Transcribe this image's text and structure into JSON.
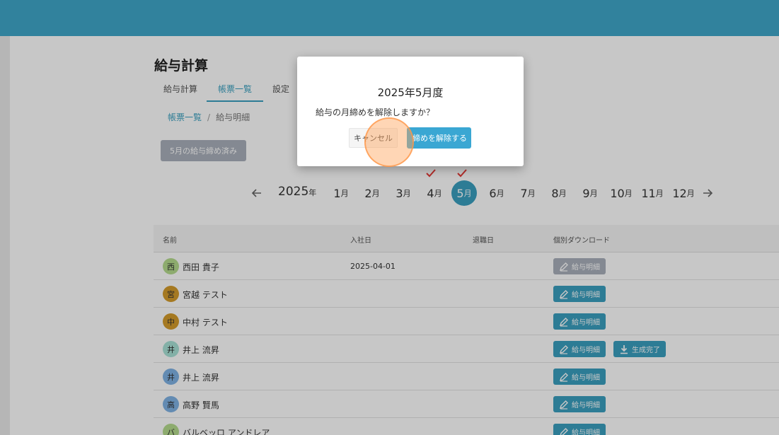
{
  "header": {
    "bar_color": "#3fa7c9"
  },
  "page": {
    "title": "給与計算",
    "tabs": [
      {
        "label": "給与計算",
        "active": false
      },
      {
        "label": "帳票一覧",
        "active": true
      },
      {
        "label": "設定",
        "active": false
      }
    ]
  },
  "breadcrumb": {
    "parent": "帳票一覧",
    "separator": "/",
    "current": "給与明細"
  },
  "status_button": {
    "label": "5月の給与締め済み"
  },
  "calendar": {
    "year": "2025",
    "year_suffix": "年",
    "month_suffix": "月",
    "months": [
      "1",
      "2",
      "3",
      "4",
      "5",
      "6",
      "7",
      "8",
      "9",
      "10",
      "11",
      "12"
    ],
    "selected_month": "5",
    "checked_months": [
      "4",
      "5"
    ]
  },
  "table": {
    "headers": {
      "name": "名前",
      "hire_date": "入社日",
      "leave_date": "退職日",
      "download": "個別ダウンロード"
    },
    "rows": [
      {
        "initial": "西",
        "name": "西田 貴子",
        "hire_date": "2025-04-01",
        "avatar_color": "#b5dc8e",
        "payslip": "給与明細",
        "payslip_disabled": true,
        "generated": ""
      },
      {
        "initial": "宮",
        "name": "宮越 テスト",
        "hire_date": "",
        "avatar_color": "#d49b2b",
        "payslip": "給与明細",
        "payslip_disabled": false,
        "generated": ""
      },
      {
        "initial": "中",
        "name": "中村 テスト",
        "hire_date": "",
        "avatar_color": "#d49b2b",
        "payslip": "給与明細",
        "payslip_disabled": false,
        "generated": ""
      },
      {
        "initial": "井",
        "name": "井上 流昇",
        "hire_date": "",
        "avatar_color": "#a8e2d6",
        "payslip": "給与明細",
        "payslip_disabled": false,
        "generated": "生成完了"
      },
      {
        "initial": "井",
        "name": "井上 流昇",
        "hire_date": "",
        "avatar_color": "#7fb2e5",
        "payslip": "給与明細",
        "payslip_disabled": false,
        "generated": ""
      },
      {
        "initial": "高",
        "name": "高野 賢馬",
        "hire_date": "",
        "avatar_color": "#7fb2e5",
        "payslip": "給与明細",
        "payslip_disabled": false,
        "generated": ""
      },
      {
        "initial": "バ",
        "name": "バルベッロ アンドレア",
        "hire_date": "",
        "avatar_color": "#b5dc8e",
        "payslip": "給与明細",
        "payslip_disabled": false,
        "generated": ""
      }
    ]
  },
  "dialog": {
    "title": "2025年5月度",
    "message": "給与の月締めを解除しますか？",
    "cancel_label": "キャンセル",
    "confirm_label": "締めを解除する"
  },
  "colors": {
    "accent": "#3a9fbf",
    "disabled": "#a9b0bb",
    "check": "#e53935"
  }
}
